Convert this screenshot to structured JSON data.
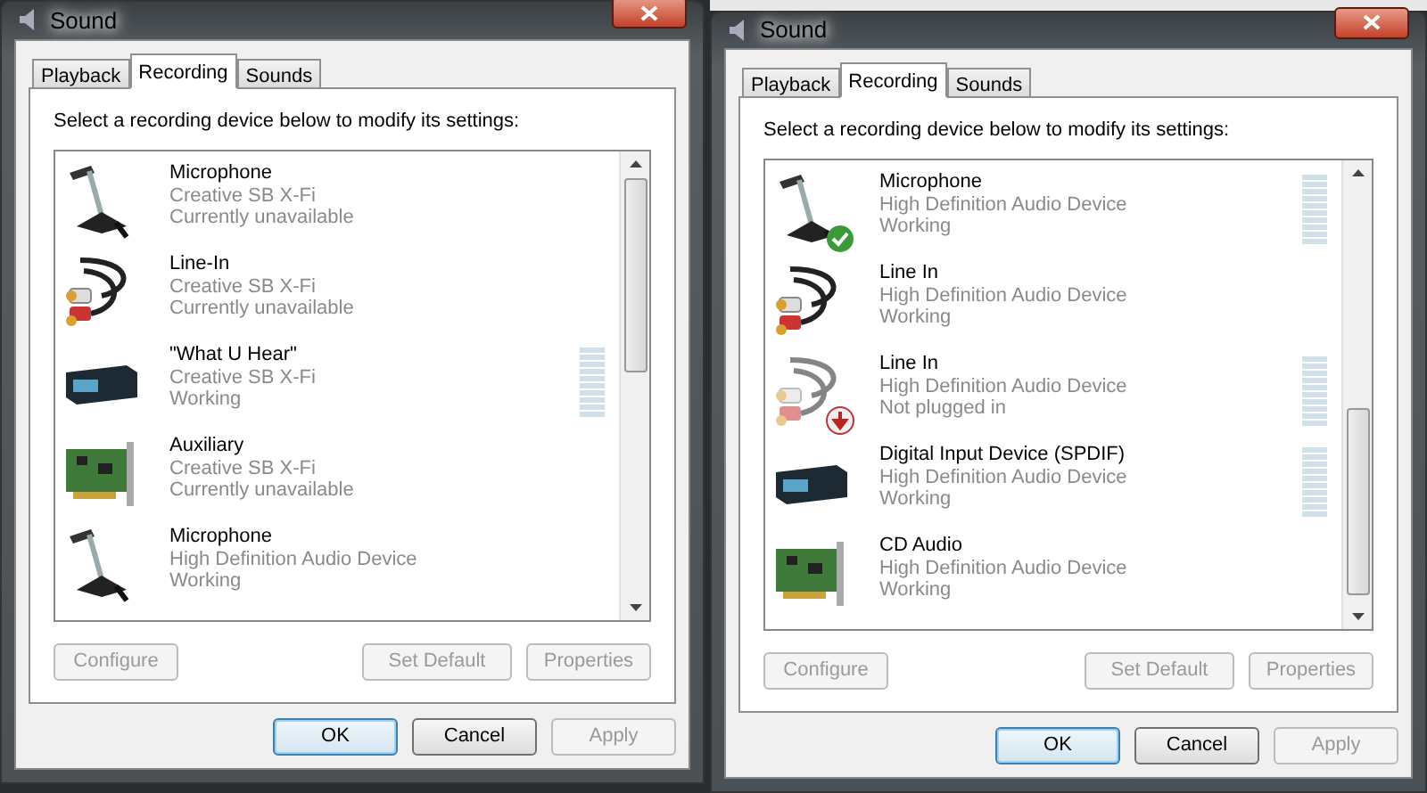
{
  "windows": [
    {
      "title": "Sound",
      "tabs": [
        {
          "label": "Playback",
          "selected": false
        },
        {
          "label": "Recording",
          "selected": true
        },
        {
          "label": "Sounds",
          "selected": false
        }
      ],
      "instruction": "Select a recording device below to modify its settings:",
      "devices": [
        {
          "kind": "microphone",
          "name": "Microphone",
          "driver": "Creative SB X-Fi",
          "status": "Currently unavailable",
          "default": false,
          "unplugged": false,
          "meter": false
        },
        {
          "kind": "cable",
          "name": "Line-In",
          "driver": "Creative SB X-Fi",
          "status": "Currently unavailable",
          "default": false,
          "unplugged": false,
          "meter": false
        },
        {
          "kind": "box",
          "name": "\"What U Hear\"",
          "driver": "Creative SB X-Fi",
          "status": "Working",
          "default": false,
          "unplugged": false,
          "meter": true
        },
        {
          "kind": "card",
          "name": "Auxiliary",
          "driver": "Creative SB X-Fi",
          "status": "Currently unavailable",
          "default": false,
          "unplugged": false,
          "meter": false
        },
        {
          "kind": "microphone",
          "name": "Microphone",
          "driver": "High Definition Audio Device",
          "status": "Working",
          "default": false,
          "unplugged": false,
          "meter": false
        }
      ],
      "buttons": [
        {
          "label": "Configure",
          "disabled": true
        },
        {
          "label": "Set Default",
          "disabled": true
        },
        {
          "label": "Properties",
          "disabled": true
        }
      ],
      "dialog_buttons": [
        {
          "label": "OK",
          "disabled": false,
          "default": true
        },
        {
          "label": "Cancel",
          "disabled": false,
          "default": false
        },
        {
          "label": "Apply",
          "disabled": true,
          "default": false
        }
      ]
    },
    {
      "title": "Sound",
      "tabs": [
        {
          "label": "Playback",
          "selected": false
        },
        {
          "label": "Recording",
          "selected": true
        },
        {
          "label": "Sounds",
          "selected": false
        }
      ],
      "instruction": "Select a recording device below to modify its settings:",
      "devices": [
        {
          "kind": "microphone",
          "name": "Microphone",
          "driver": "High Definition Audio Device",
          "status": "Working",
          "default": true,
          "unplugged": false,
          "meter": true
        },
        {
          "kind": "cable",
          "name": "Line In",
          "driver": "High Definition Audio Device",
          "status": "Working",
          "default": false,
          "unplugged": false,
          "meter": false
        },
        {
          "kind": "cable",
          "name": "Line In",
          "driver": "High Definition Audio Device",
          "status": "Not plugged in",
          "default": false,
          "unplugged": true,
          "meter": true
        },
        {
          "kind": "box",
          "name": "Digital Input Device (SPDIF)",
          "driver": "High Definition Audio Device",
          "status": "Working",
          "default": false,
          "unplugged": false,
          "meter": true
        },
        {
          "kind": "card",
          "name": "CD Audio",
          "driver": "High Definition Audio Device",
          "status": "Working",
          "default": false,
          "unplugged": false,
          "meter": false
        }
      ],
      "buttons": [
        {
          "label": "Configure",
          "disabled": true
        },
        {
          "label": "Set Default",
          "disabled": true
        },
        {
          "label": "Properties",
          "disabled": true
        }
      ],
      "dialog_buttons": [
        {
          "label": "OK",
          "disabled": false,
          "default": true
        },
        {
          "label": "Cancel",
          "disabled": false,
          "default": false
        },
        {
          "label": "Apply",
          "disabled": true,
          "default": false
        }
      ]
    }
  ]
}
